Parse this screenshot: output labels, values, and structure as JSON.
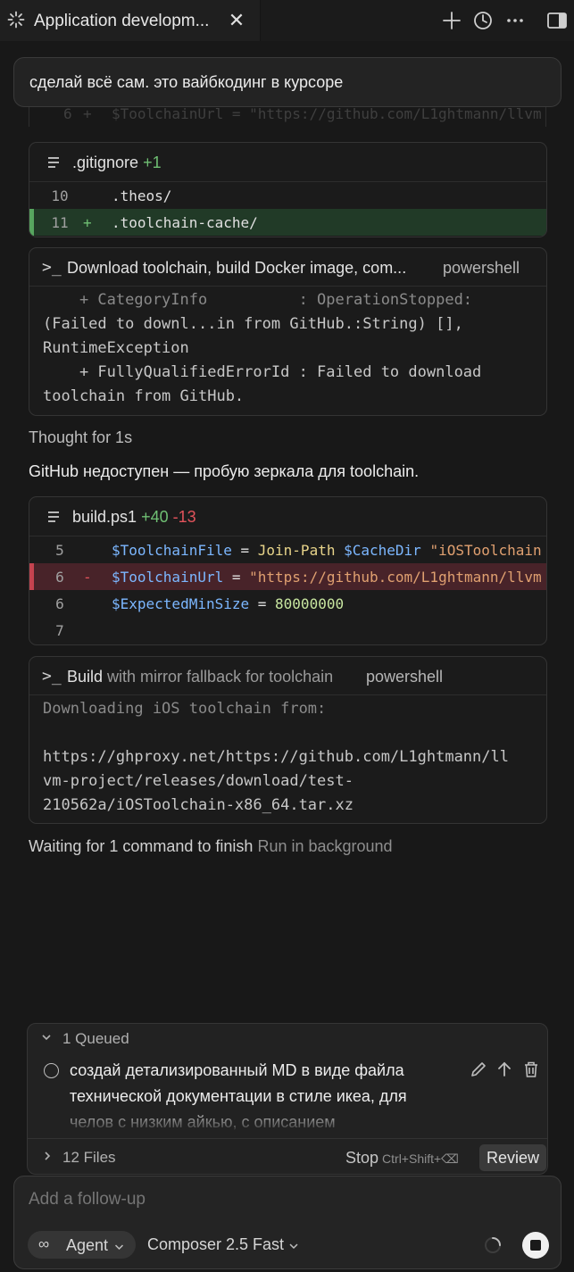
{
  "tab": {
    "title": "Application developm...",
    "close": "✕"
  },
  "user_message": "сделай всё сам. это вайбкодинг в курсоре",
  "ghost_line": {
    "ln": "6",
    "sign": "+",
    "code": "$ToolchainUrl = \"https://github.com/L1ghtmann/llvm"
  },
  "gitignore": {
    "file": ".gitignore",
    "added": "+1",
    "rows": [
      {
        "ln": "10",
        "sign": "",
        "code": ".theos/"
      },
      {
        "ln": "11",
        "sign": "+",
        "code": ".toolchain-cache/"
      }
    ]
  },
  "terminal1": {
    "title": "Download toolchain, build Docker image, com...",
    "tag": "powershell",
    "lines": [
      "    + CategoryInfo          : OperationStopped:",
      "(Failed to downl...in from GitHub.:String) [],",
      "RuntimeException",
      "    + FullyQualifiedErrorId : Failed to download",
      "toolchain from GitHub."
    ]
  },
  "thought": "Thought for 1s",
  "assistant_text": "GitHub недоступен — пробую зеркала для toolchain.",
  "build": {
    "file": "build.ps1",
    "added": "+40",
    "removed": "-13",
    "rows": [
      {
        "ln": "5",
        "sign": "",
        "var": "$ToolchainFile",
        "op": " = ",
        "fn": "Join-Path",
        "rest": " $CacheDir ",
        "str": "\"iOSToolchain"
      },
      {
        "ln": "6",
        "sign": "-",
        "var": "$ToolchainUrl",
        "op": " = ",
        "str": "\"https://github.com/L1ghtmann/llvm"
      },
      {
        "ln": "6",
        "sign": "",
        "var": "$ExpectedMinSize",
        "op": " = ",
        "num": "80000000"
      },
      {
        "ln": "7",
        "sign": ""
      }
    ]
  },
  "terminal2": {
    "title_strong": "Build",
    "title_dim": "with mirror fallback for toolchain",
    "tag": "powershell",
    "lines": [
      "Downloading iOS toolchain from:",
      "",
      "https://ghproxy.net/https://github.com/L1ghtmann/ll",
      "vm-project/releases/download/test-",
      "210562a/iOSToolchain-x86_64.tar.xz"
    ]
  },
  "waiting": {
    "text": "Waiting for 1 command to finish",
    "action": "Run in background"
  },
  "queue": {
    "label": "1 Queued",
    "item": "создай детализированный MD в виде файла технической документации в стиле икеа, для челов с низким айкью, с описанием",
    "files": "12 Files",
    "stop": "Stop",
    "stop_shortcut": "Ctrl+Shift+⌫",
    "review": "Review"
  },
  "composer": {
    "placeholder": "Add a follow-up",
    "agent": "Agent",
    "model": "Composer 2.5 Fast"
  },
  "colors": {
    "add": "#6fbf73",
    "del": "#e2535b",
    "var": "#7cb7ff",
    "fn": "#e8d48a",
    "str": "#e0a070",
    "num": "#c8e6a0"
  }
}
